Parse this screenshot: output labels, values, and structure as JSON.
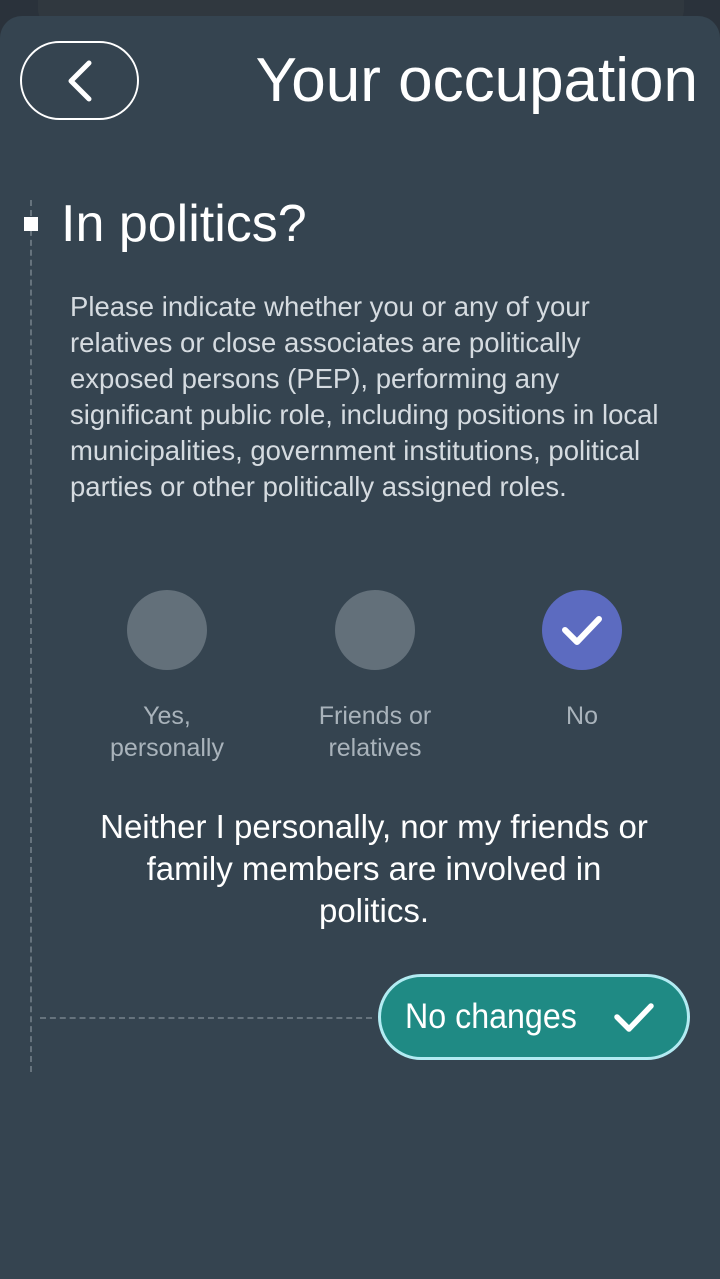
{
  "header": {
    "title": "Your occupation",
    "back_icon": "chevron-left-icon"
  },
  "section": {
    "title": "In politics?",
    "description": "Please indicate whether you or any of your relatives or close associates are politically exposed persons (PEP), performing any significant public role, including positions in local municipalities, government institutions, political parties or other politically assigned roles."
  },
  "options": [
    {
      "label_line1": "Yes,",
      "label_line2": "personally",
      "selected": false
    },
    {
      "label_line1": "Friends or",
      "label_line2": "relatives",
      "selected": false
    },
    {
      "label_line1": "No",
      "label_line2": "",
      "selected": true,
      "icon": "checkmark-icon"
    }
  ],
  "statement": {
    "line1": "Neither I personally, nor my friends or",
    "line2": "family members are involved in",
    "line3": "politics."
  },
  "actions": {
    "confirm_label": "No changes",
    "confirm_icon": "checkmark-icon"
  },
  "colors": {
    "background": "#354450",
    "selected_option": "#5c6bc0",
    "unselected_option": "#63707a",
    "confirm_button": "#1f8a84",
    "confirm_border": "#b2ebf2"
  }
}
